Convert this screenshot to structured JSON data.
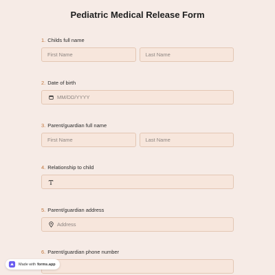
{
  "form": {
    "title": "Pediatric Medical Release Form"
  },
  "questions": [
    {
      "number": "1.",
      "label": "Childs full name",
      "fields": [
        {
          "placeholder": "First Name"
        },
        {
          "placeholder": "Last Name"
        }
      ]
    },
    {
      "number": "2.",
      "label": "Date of birth",
      "icon": "calendar-icon",
      "placeholder": "MM/DD/YYYY"
    },
    {
      "number": "3.",
      "label": "Parent/guardian full name",
      "fields": [
        {
          "placeholder": "First Name"
        },
        {
          "placeholder": "Last Name"
        }
      ]
    },
    {
      "number": "4.",
      "label": "Relationship to child",
      "icon": "text-icon",
      "placeholder": ""
    },
    {
      "number": "5.",
      "label": "Parent/guardian address",
      "icon": "location-pin-icon",
      "placeholder": "Address"
    },
    {
      "number": "6.",
      "label": "Parent/guardian phone number",
      "placeholder": ""
    }
  ],
  "badge": {
    "prefix": "Made with",
    "brand": "forms.app"
  },
  "colors": {
    "background": "#f6ebe6",
    "accent_number": "#c0743a",
    "field_border": "#e3c6b3",
    "field_bg": "#f7e6dc"
  }
}
